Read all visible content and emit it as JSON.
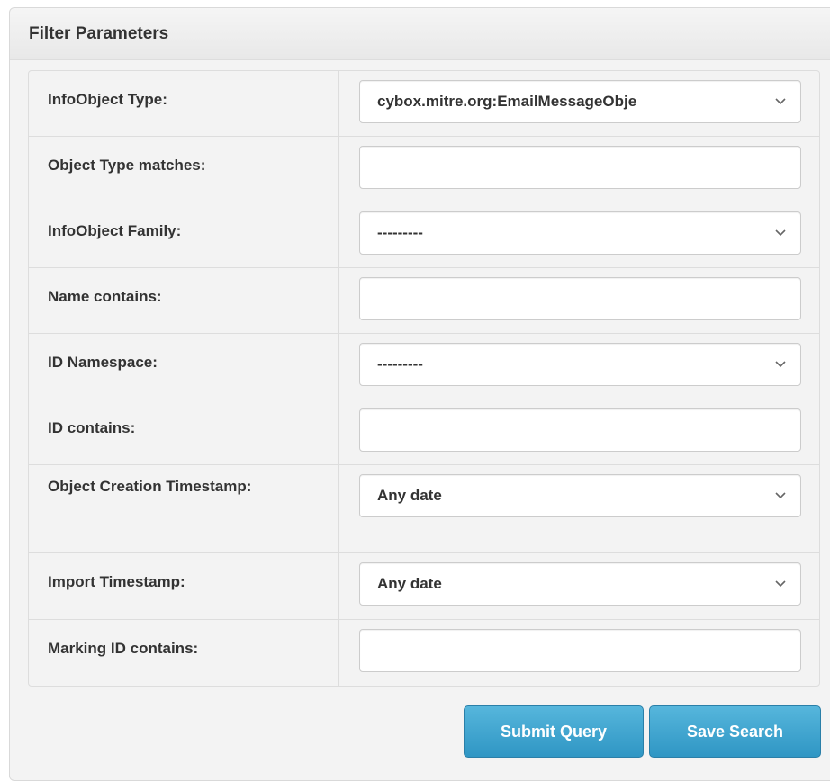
{
  "panel": {
    "title": "Filter Parameters"
  },
  "filters": [
    {
      "label": "InfoObject Type:",
      "type": "select",
      "value": "cybox.mitre.org:EmailMessageObje"
    },
    {
      "label": "Object Type matches:",
      "type": "input",
      "value": ""
    },
    {
      "label": "InfoObject Family:",
      "type": "select",
      "value": "---------"
    },
    {
      "label": "Name contains:",
      "type": "input",
      "value": ""
    },
    {
      "label": "ID Namespace:",
      "type": "select",
      "value": "---------"
    },
    {
      "label": "ID contains:",
      "type": "input",
      "value": ""
    },
    {
      "label": "Object Creation Timestamp:",
      "type": "select",
      "value": "Any date"
    },
    {
      "label": "Import Timestamp:",
      "type": "select",
      "value": "Any date"
    },
    {
      "label": "Marking ID contains:",
      "type": "input",
      "value": ""
    }
  ],
  "buttons": {
    "submit_label": "Submit Query",
    "save_label": "Save Search"
  },
  "icons": {
    "dropdown": "chevron-down-icon"
  },
  "colors": {
    "button_accent": "#2f96c4",
    "panel_bg": "#f3f3f3"
  }
}
